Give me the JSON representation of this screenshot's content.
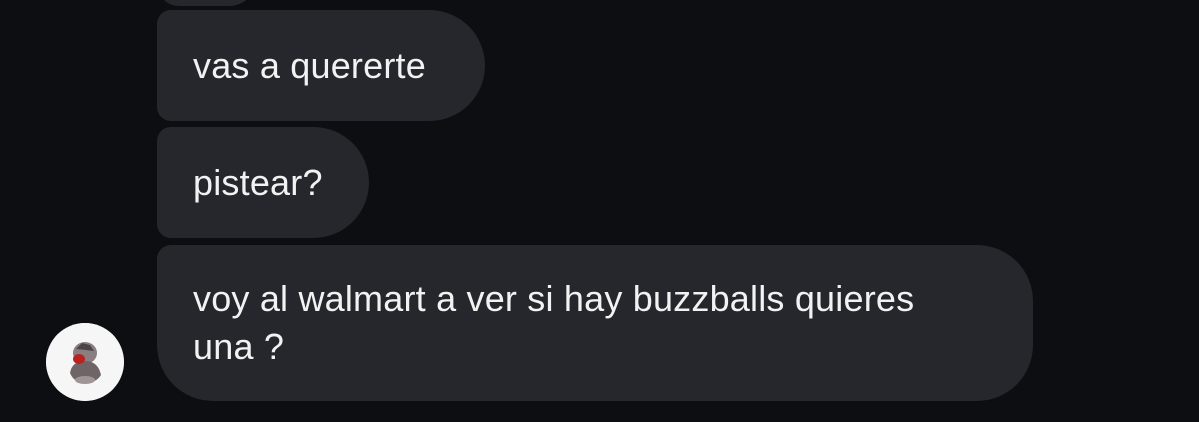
{
  "colors": {
    "background": "#0c0e12",
    "bubble": "#25272c",
    "text": "#f2f2f2",
    "avatar_bg": "#f7f6f6"
  },
  "messages": [
    {
      "text": "vas a quererte"
    },
    {
      "text": "pistear?"
    },
    {
      "text": "voy al walmart a ver si hay buzzballs quieres\nuna ?"
    }
  ],
  "sender": {
    "avatar_icon": "profile-avatar-icon"
  }
}
